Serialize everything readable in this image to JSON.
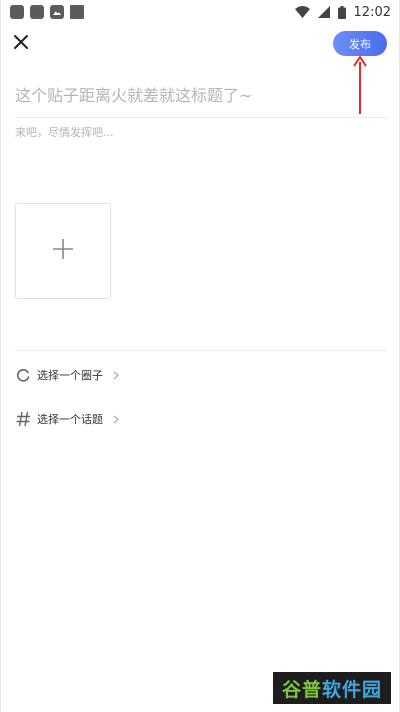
{
  "status_bar": {
    "time": "12:02",
    "icons": [
      "notification-icon",
      "notification-icon",
      "image-notification-icon",
      "notification-icon",
      "wifi-icon",
      "signal-icon",
      "battery-icon"
    ]
  },
  "header": {
    "close_icon": "close-icon",
    "publish_label": "发布"
  },
  "post": {
    "title_placeholder": "这个贴子距离火就差就这标题了~",
    "content_placeholder": "来吧，尽情发挥吧...",
    "add_image_icon": "plus-icon"
  },
  "options": [
    {
      "icon": "circle-icon",
      "label": "选择一个圈子"
    },
    {
      "icon": "hash-icon",
      "label": "选择一个话题"
    }
  ],
  "watermark": {
    "part_a": "谷普",
    "part_b": "软件园"
  },
  "colors": {
    "accent": "#4a6cf0",
    "annotation": "#e8282b",
    "text": "#333333",
    "placeholder": "#b4b4b4"
  }
}
